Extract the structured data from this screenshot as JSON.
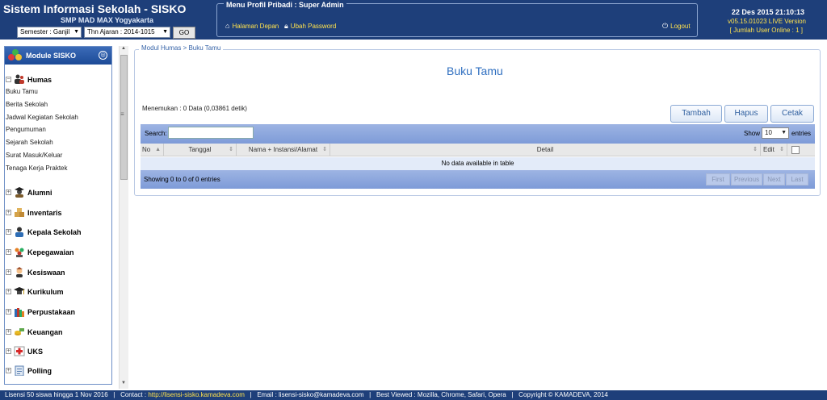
{
  "header": {
    "app_title": "Sistem Informasi Sekolah - SISKO",
    "school_name": "SMP MAD MAX Yogyakarta",
    "semester_select": "Semester : Ganjil",
    "year_select": "Thn Ajaran : 2014-1015",
    "go_label": "GO",
    "menu_title": "Menu Profil Pribadi : Super Admin",
    "home_link": "Halaman Depan",
    "password_link": "Ubah Password",
    "logout_link": "Logout",
    "datetime": "22 Des 2015 21:10:13",
    "version": "v05.15.01023 LIVE Version",
    "online_users": "[ Jumlah User Online : 1 ]"
  },
  "sidebar": {
    "title": "Module SISKO",
    "humas": {
      "label": "Humas",
      "items": [
        "Buku Tamu",
        "Berita Sekolah",
        "Jadwal Kegiatan Sekolah",
        "Pengumuman",
        "Sejarah Sekolah",
        "Surat Masuk/Keluar",
        "Tenaga Kerja Praktek"
      ]
    },
    "sections": [
      "Alumni",
      "Inventaris",
      "Kepala Sekolah",
      "Kepegawaian",
      "Kesiswaan",
      "Kurikulum",
      "Perpustakaan",
      "Keuangan",
      "UKS",
      "Polling"
    ]
  },
  "main": {
    "breadcrumb": "Modul Humas > Buku Tamu",
    "title": "Buku Tamu",
    "result_info": "Menemukan : 0 Data (0,03861 detik)",
    "buttons": {
      "add": "Tambah",
      "delete": "Hapus",
      "print": "Cetak"
    },
    "table": {
      "search_label": "Search:",
      "search_value": "",
      "show_label": "Show",
      "length_value": "10",
      "entries_label": "entries",
      "columns": [
        "No",
        "Tanggal",
        "Nama + Instansi/Alamat",
        "Detail",
        "Edit"
      ],
      "empty_message": "No data available in table",
      "info": "Showing 0 to 0 of 0 entries",
      "pagination": [
        "First",
        "Previous",
        "Next",
        "Last"
      ]
    }
  },
  "footer": {
    "license": "Lisensi 50 siswa hingga 1 Nov 2016",
    "contact_label": "Contact :",
    "contact_url": "http://lisensi-sisko.kamadeva.com",
    "email": "Email : lisensi-sisko@kamadeva.com",
    "browsers": "Best Viewed : Mozilla, Chrome, Safari, Opera",
    "copyright": "Copyright © KAMADEVA, 2014"
  },
  "colors": {
    "header_bg": "#1e3f7a",
    "accent_yellow": "#ffe24d",
    "title_blue": "#2f6fc0",
    "table_bar": "#8aa5dd"
  },
  "icons": [
    "home-icon",
    "lock-icon",
    "power-icon",
    "module-logo-icon",
    "collapse-icon",
    "expand-toggle-icon",
    "sort-icon",
    "dropdown-arrow-icon"
  ]
}
